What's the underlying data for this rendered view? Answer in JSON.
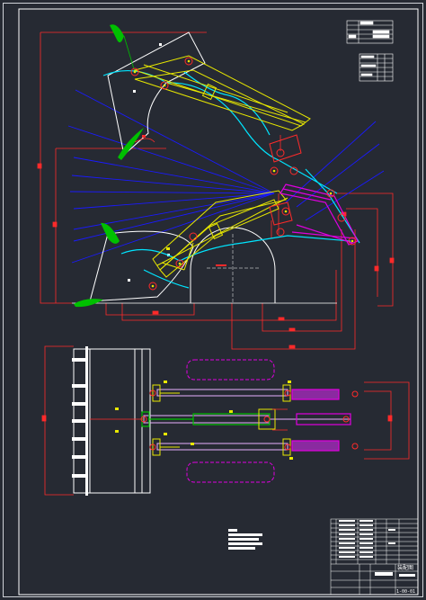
{
  "drawing": {
    "background": "#262a33",
    "colors": {
      "frame": "#ffffff",
      "dimension": "#ff2a2a",
      "centerline": "#1a1aff",
      "bucket": "#ffffff",
      "boom": "#e8e800",
      "arm": "#00e5ff",
      "cylinder_rod": "#d040ff",
      "teeth": "#00c000",
      "wheel": "#ffffff",
      "magenta": "#e000e0"
    }
  },
  "title_block": {
    "drawing_number": "1-00-01",
    "label": "装配图"
  }
}
